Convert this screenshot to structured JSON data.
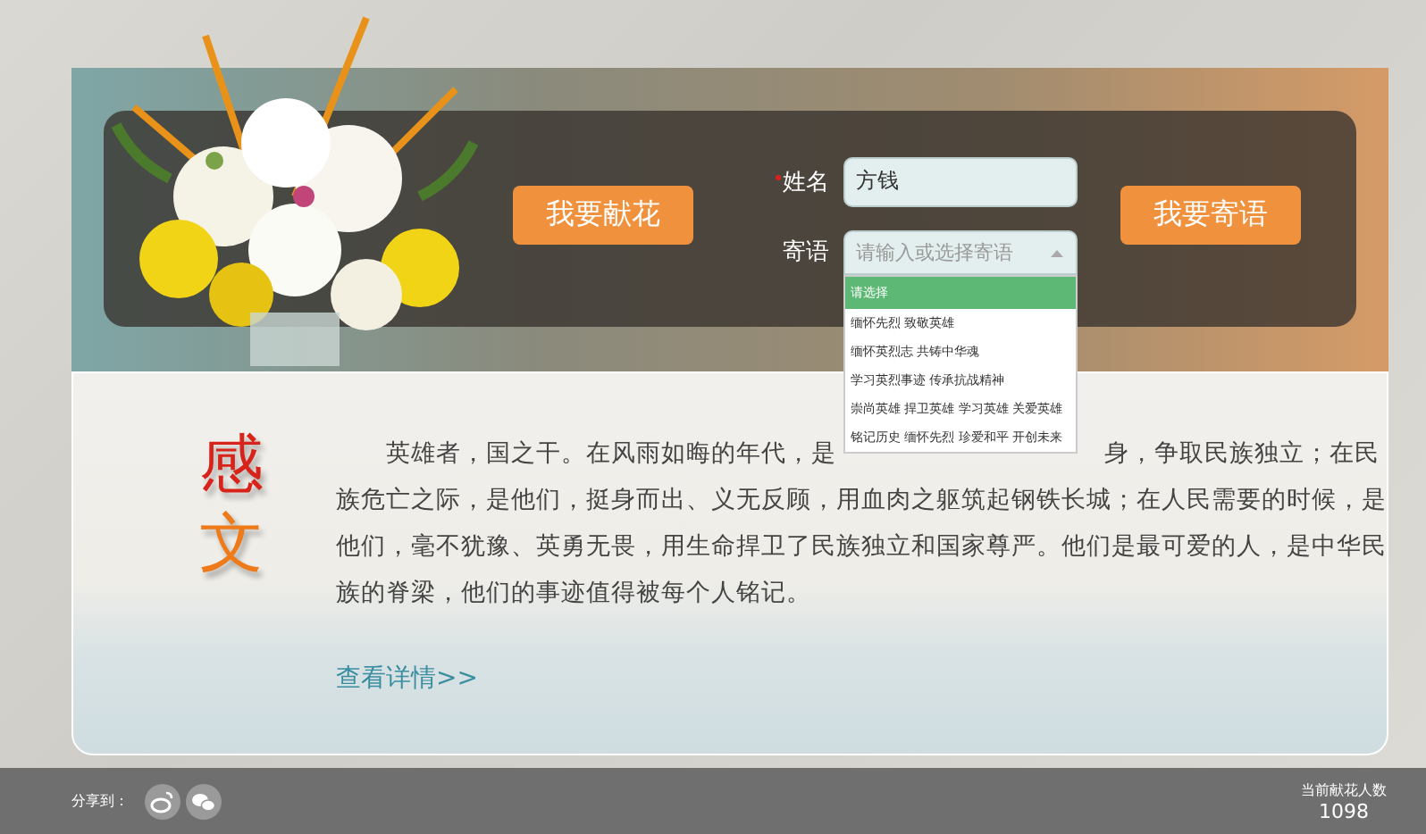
{
  "banner": {
    "offer_flower_button": "我要献花",
    "send_message_button": "我要寄语",
    "form": {
      "name": {
        "label": "姓名",
        "required": true,
        "value": "方钱"
      },
      "message": {
        "label": "寄语",
        "placeholder": "请输入或选择寄语",
        "expanded": true,
        "options": [
          {
            "label": "请选择",
            "selected": true
          },
          {
            "label": "缅怀先烈 致敬英雄",
            "selected": false
          },
          {
            "label": "缅怀英烈志 共铸中华魂",
            "selected": false
          },
          {
            "label": "学习英烈事迹 传承抗战精神",
            "selected": false
          },
          {
            "label": "崇尚英雄 捍卫英雄 学习英雄 关爱英雄",
            "selected": false
          },
          {
            "label": "铭记历史 缅怀先烈 珍爱和平 开创未来",
            "selected": false
          }
        ]
      }
    }
  },
  "article": {
    "title_chars": [
      "感",
      "文"
    ],
    "lines": [
      [
        "英雄者，国之干。在风雨如晦的年代，是",
        "身，争取民族独立；在民"
      ],
      [
        "族危亡之际，是他们，挺身而出、义无反顾，用血肉之躯筑起钢铁长城；在人民需要的时候，是"
      ],
      [
        "他们，毫不犹豫、英勇无畏，用生命捍卫了民族独立和国家尊严。他们是最可爱的人，是中华民"
      ],
      [
        "族的脊梁，他们的事迹值得被每个人铭记。"
      ]
    ],
    "more_link": "查看详情>>"
  },
  "footer": {
    "share_label": "分享到：",
    "counter_label": "当前献花人数",
    "counter_value": "1098"
  }
}
